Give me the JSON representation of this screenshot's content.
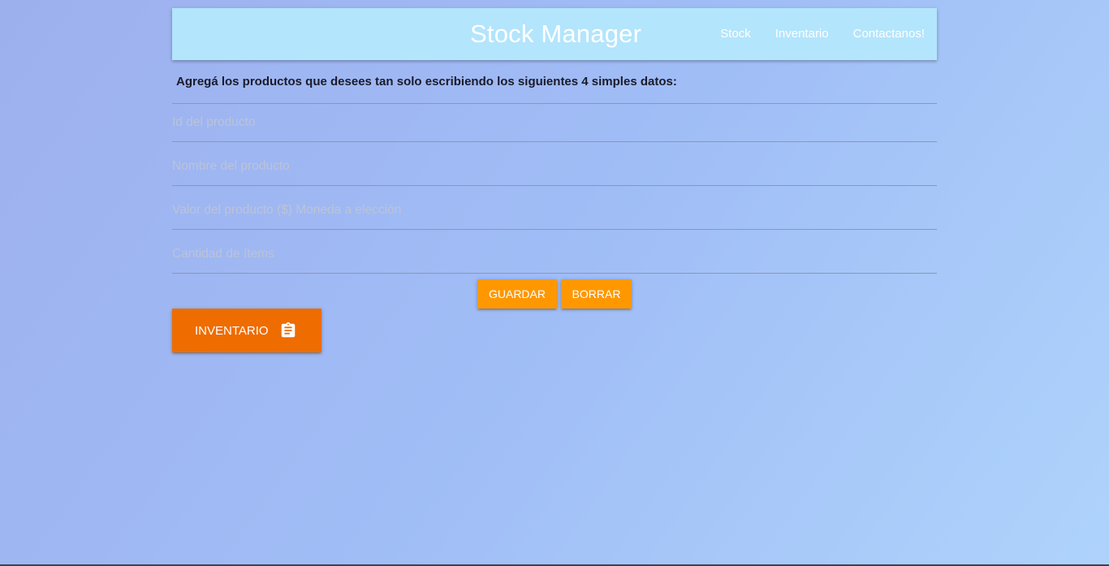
{
  "navbar": {
    "brand": "Stock Manager",
    "links": [
      "Stock",
      "Inventario",
      "Contactanos!"
    ]
  },
  "intro_text": "Agregá los productos que desees tan solo escribiendo los siguientes 4 simples datos:",
  "form": {
    "fields": [
      {
        "placeholder": "Id del producto",
        "value": ""
      },
      {
        "placeholder": "Nombre del producto",
        "value": ""
      },
      {
        "placeholder": "Valor del producto ($) Moneda a elección",
        "value": ""
      },
      {
        "placeholder": "Cantidad de ítems",
        "value": ""
      }
    ],
    "save_label": "Guardar",
    "clear_label": "Borrar"
  },
  "inventory_button": {
    "label": "INVENTARIO",
    "icon": "clipboard-icon"
  },
  "colors": {
    "navbar_bg": "#b3e5fc",
    "button_orange": "#ff9800",
    "button_dark_orange": "#ef6c00"
  }
}
